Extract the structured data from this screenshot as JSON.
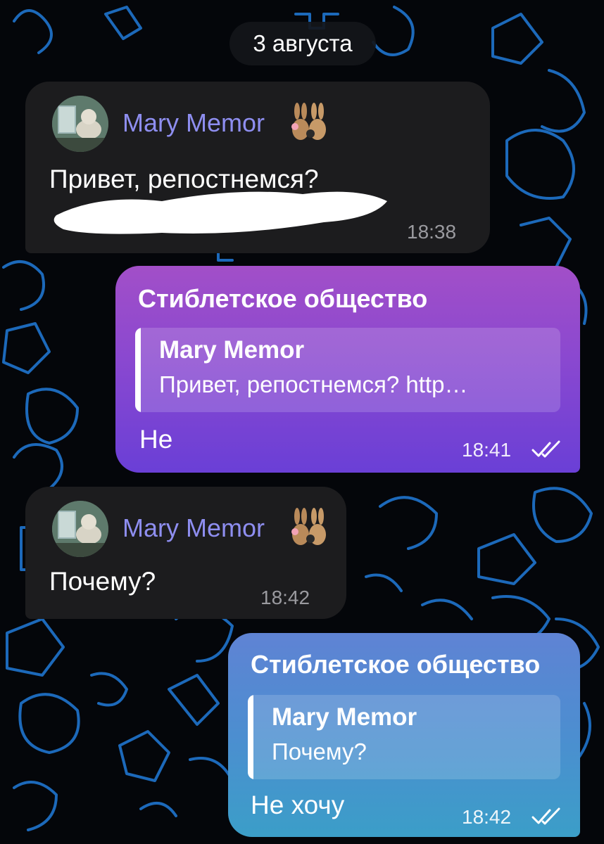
{
  "date_separator": "3 августа",
  "messages": [
    {
      "sender": "Mary Memor",
      "text": "Привет, репостнемся?",
      "time": "18:38",
      "redacted_link": true
    },
    {
      "channel": "Стиблетское общество",
      "reply_author": "Mary Memor",
      "reply_text": "Привет, репостнемся? http…",
      "text": "Не",
      "time": "18:41",
      "read_icon": "double-check-icon"
    },
    {
      "sender": "Mary Memor",
      "text": "Почему?",
      "time": "18:42"
    },
    {
      "channel": "Стиблетское общество",
      "reply_author": "Mary Memor",
      "reply_text": "Почему?",
      "text": "Не хочу",
      "time": "18:42",
      "read_icon": "double-check-icon"
    }
  ],
  "colors": {
    "incoming_bubble": "#1c1c1e",
    "sender_name": "#8e8ef0",
    "outgoing_purple_top": "#a24fc8",
    "outgoing_purple_bottom": "#6a3fd6",
    "outgoing_blue_top": "#5f83d4",
    "outgoing_blue_bottom": "#3b9ec8",
    "wallpaper_lines": "#1e6fc4"
  }
}
